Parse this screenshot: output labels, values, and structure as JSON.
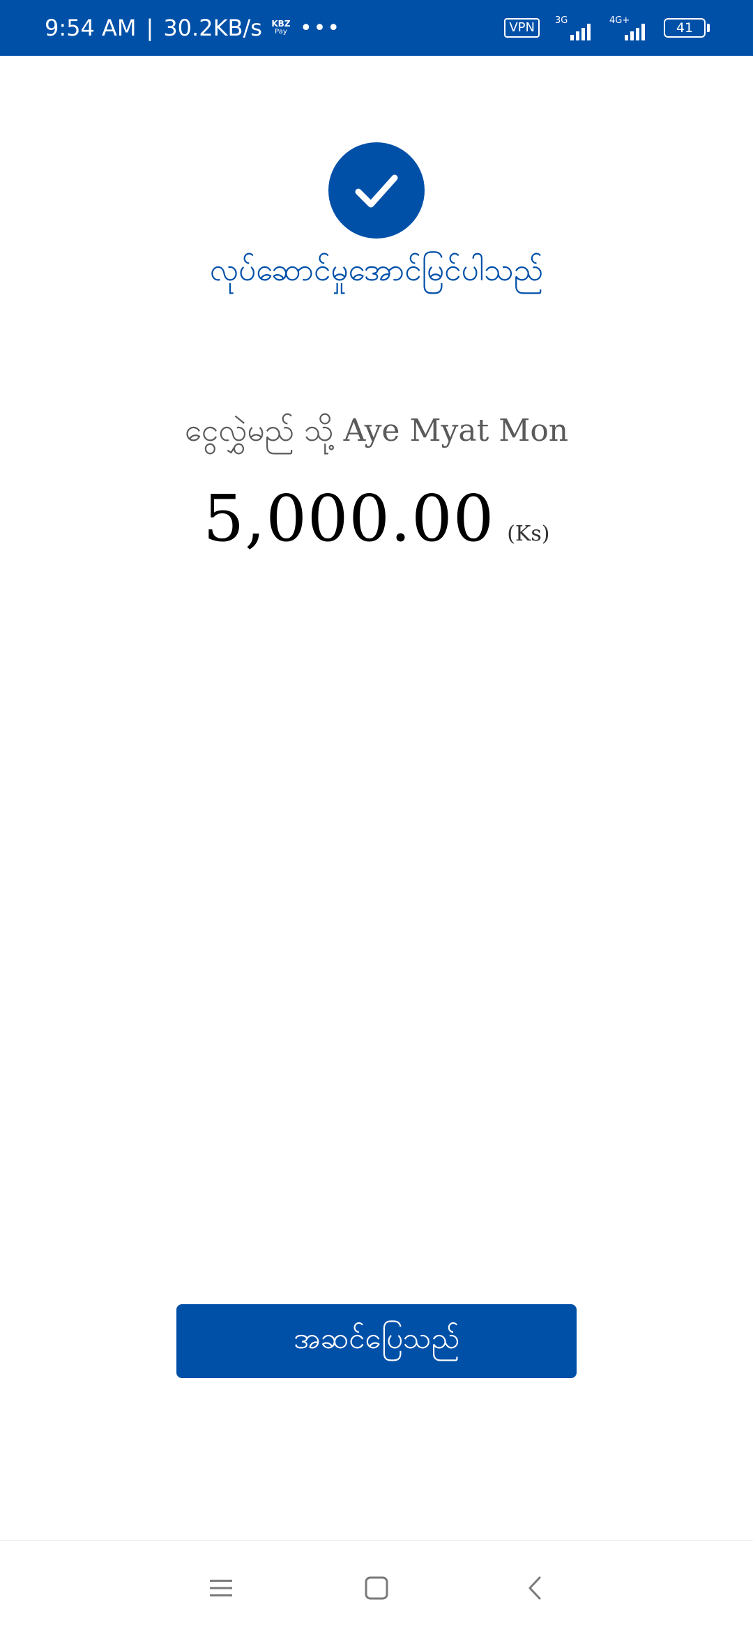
{
  "status_bar": {
    "time": "9:54 AM",
    "separator": "|",
    "speed": "30.2KB/s",
    "app_badge": "KBZ",
    "app_badge_sub": "Pay",
    "more": "•••",
    "vpn": "VPN",
    "network_1": "3G",
    "network_2": "4G+",
    "battery": "41",
    "background_color": "#0150a8"
  },
  "result": {
    "icon": "check-icon",
    "title": "လုပ်ဆောင်မှုအောင်မြင်ပါသည်",
    "accent_color": "#0150a8"
  },
  "transfer": {
    "to_label": "ငွေလွှဲမည် သို့",
    "recipient_name": "Aye Myat Mon",
    "amount": "5,000.00",
    "currency": "(Ks)"
  },
  "actions": {
    "done_label": "အဆင်ပြေသည်"
  },
  "nav_bar": {
    "icons": [
      "menu-icon",
      "home-square-icon",
      "back-chevron-icon"
    ]
  }
}
